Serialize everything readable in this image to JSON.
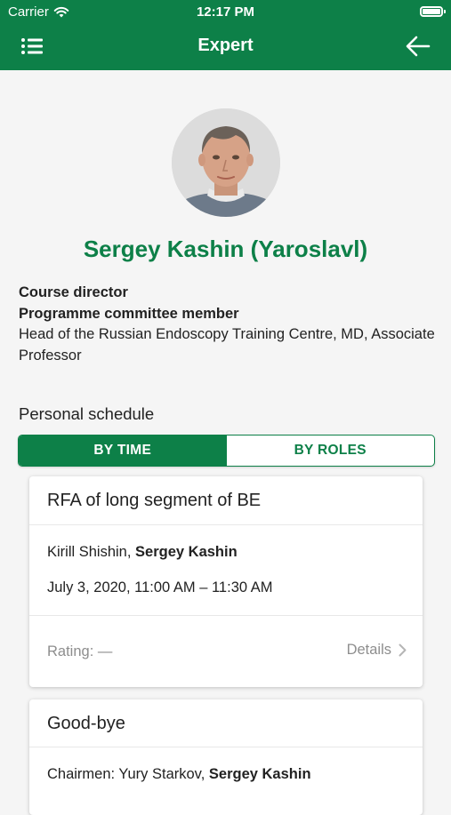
{
  "status_bar": {
    "carrier": "Carrier",
    "time": "12:17 PM"
  },
  "navbar": {
    "title": "Expert",
    "menu_icon": "list-menu-icon",
    "back_icon": "arrow-left-icon"
  },
  "expert": {
    "name": "Sergey Kashin (Yaroslavl)",
    "roles": [
      "Course director",
      "Programme committee member"
    ],
    "description": "Head of the Russian Endoscopy Training Centre, MD, Associate Professor"
  },
  "schedule": {
    "title": "Personal schedule",
    "tabs": [
      {
        "label": "BY TIME",
        "active": true
      },
      {
        "label": "BY ROLES",
        "active": false
      }
    ],
    "events": [
      {
        "title": "RFA of long segment of BE",
        "speakers_prefix": "Kirill Shishin, ",
        "speakers_highlight": "Sergey Kashin",
        "datetime": "July 3, 2020, 11:00 AM – 11:30 AM",
        "rating": "Rating: —",
        "details_label": "Details"
      },
      {
        "title": "Good-bye",
        "speakers_prefix": "Chairmen: Yury Starkov, ",
        "speakers_highlight": "Sergey Kashin"
      }
    ]
  },
  "colors": {
    "primary": "#0d8048",
    "background": "#f5f5f5",
    "muted": "#8e8e8e"
  }
}
